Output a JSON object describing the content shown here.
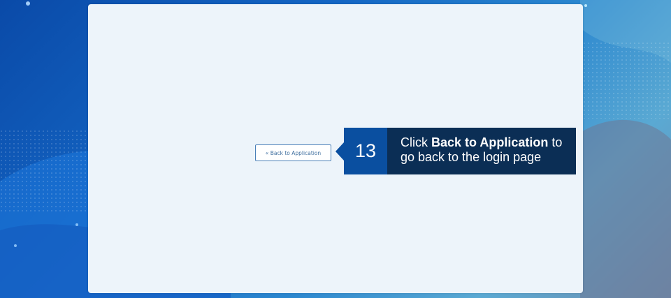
{
  "button": {
    "back_label": "« Back to Application"
  },
  "callout": {
    "step_number": "13",
    "text_before": "Click ",
    "text_bold": "Back to Application",
    "text_after": " to go back to the login page"
  },
  "colors": {
    "panel": "#edf4fa",
    "step_badge": "#0a4fa0",
    "instruction_box": "#0b2e55",
    "button_border": "#4a7fb8"
  }
}
